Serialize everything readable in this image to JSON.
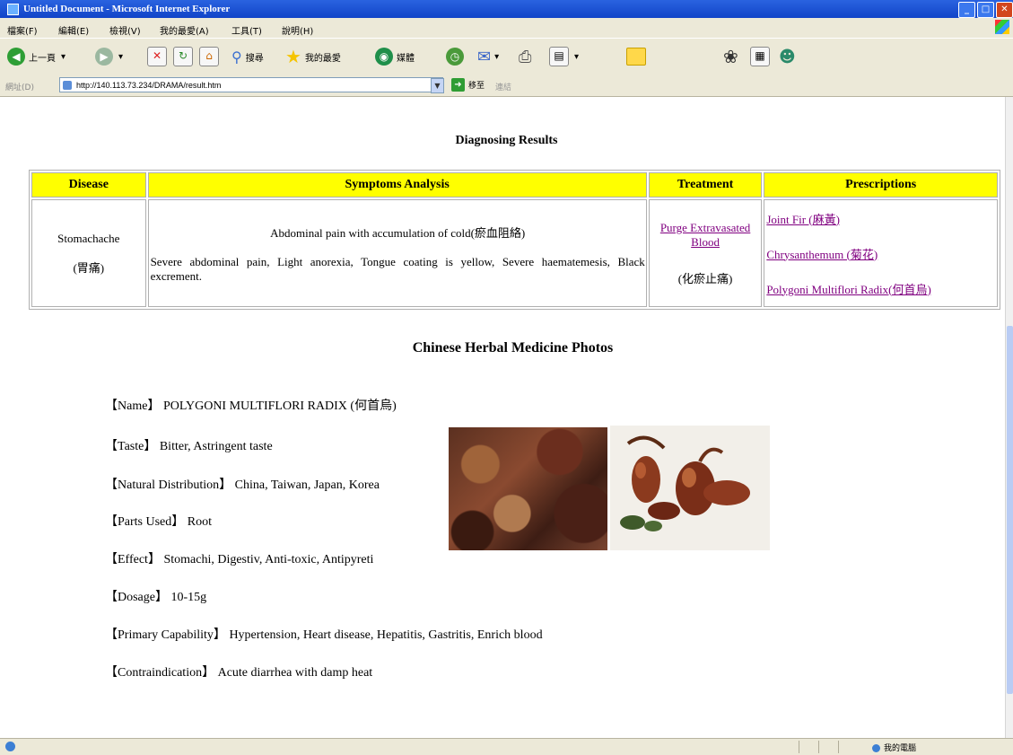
{
  "window": {
    "title": "Untitled Document - Microsoft Internet Explorer"
  },
  "menubar": {
    "items": [
      "檔案(F)",
      "編輯(E)",
      "檢視(V)",
      "我的最愛(A)",
      "工具(T)",
      "說明(H)"
    ]
  },
  "toolbar": {
    "back_label": "上一頁",
    "search_label": "搜尋",
    "favorites_label": "我的最愛",
    "media_label": "媒體"
  },
  "address": {
    "label": "網址(D)",
    "url": "http://140.113.73.234/DRAMA/result.htm",
    "go_label": "移至",
    "links_label": "連結"
  },
  "results": {
    "title": "Diagnosing Results",
    "headers": [
      "Disease",
      "Symptoms Analysis",
      "Treatment",
      "Prescriptions"
    ],
    "disease": {
      "name": "Stomachache",
      "chinese": "(胃痛)"
    },
    "symptoms": {
      "analysis": "Abdominal pain with accumulation of cold(瘀血阻絡)",
      "details": "Severe abdominal pain, Light anorexia, Tongue coating is yellow, Severe haematemesis, Black excrement."
    },
    "treatment": {
      "link": "Purge Extravasated Blood",
      "chinese": "(化瘀止痛)"
    },
    "prescriptions": [
      "Joint Fir (麻黃)",
      "Chrysanthemum (菊花)",
      "Polygoni Multiflori Radix(何首烏)"
    ]
  },
  "herb": {
    "section_title": "Chinese Herbal Medicine Photos",
    "fields": [
      {
        "label": "【Name】",
        "value": "POLYGONI MULTIFLORI RADIX (何首烏)"
      },
      {
        "label": "【Taste】",
        "value": "Bitter, Astringent taste"
      },
      {
        "label": "【Natural Distribution】",
        "value": "China, Taiwan, Japan, Korea"
      },
      {
        "label": "【Parts Used】",
        "value": "Root"
      },
      {
        "label": "【Effect】",
        "value": "Stomachi, Digestiv, Anti-toxic, Antipyreti"
      },
      {
        "label": "【Dosage】",
        "value": "10-15g"
      },
      {
        "label": "【Primary Capability】",
        "value": "Hypertension, Heart disease, Hepatitis, Gastritis, Enrich blood"
      },
      {
        "label": "【Contraindication】",
        "value": "Acute diarrhea with damp heat"
      }
    ]
  },
  "statusbar": {
    "zone": "我的電腦"
  },
  "colors": {
    "header_bg": "#ffff00",
    "link": "#800080",
    "titlebar": "#1f55d6"
  }
}
